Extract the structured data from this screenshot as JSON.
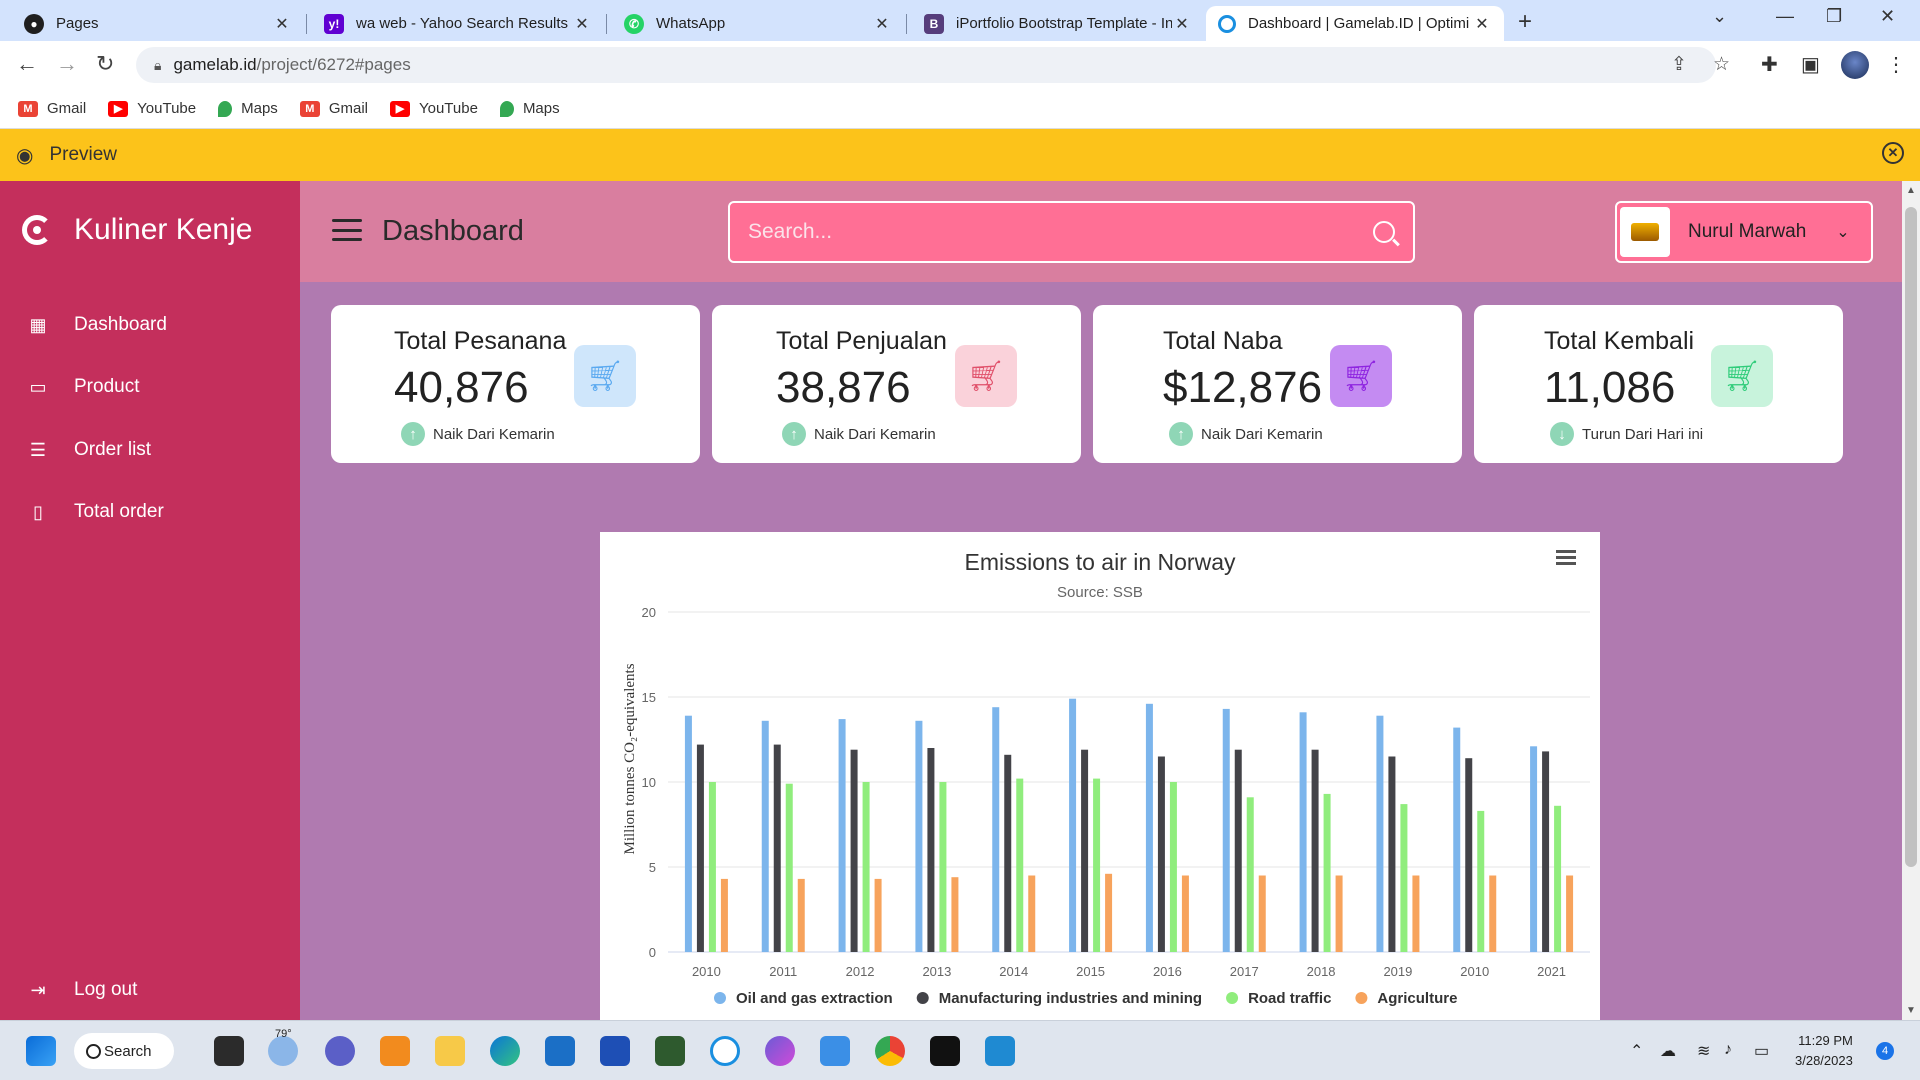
{
  "browser": {
    "tabs": [
      {
        "title": "Pages",
        "icon": "github-icon",
        "color": "#1f1f1f"
      },
      {
        "title": "wa web - Yahoo Search Results",
        "icon": "yahoo-icon",
        "color": "#6001d2"
      },
      {
        "title": "WhatsApp",
        "icon": "whatsapp-icon",
        "color": "#25d366"
      },
      {
        "title": "iPortfolio Bootstrap Template - In",
        "icon": "bootstrap-icon",
        "color": "#563d7c"
      },
      {
        "title": "Dashboard | Gamelab.ID | Optimi",
        "icon": "gamelab-icon",
        "color": "#1a8fe0"
      }
    ],
    "url_host": "gamelab.id",
    "url_path": "/project/6272#pages",
    "bookmarks": [
      {
        "label": "Gmail",
        "icon": "gmail-icon",
        "color": "#ea4335"
      },
      {
        "label": "YouTube",
        "icon": "youtube-icon",
        "color": "#ff0000"
      },
      {
        "label": "Maps",
        "icon": "maps-icon",
        "color": "#34a853"
      },
      {
        "label": "Gmail",
        "icon": "gmail-icon",
        "color": "#ea4335"
      },
      {
        "label": "YouTube",
        "icon": "youtube-icon",
        "color": "#ff0000"
      },
      {
        "label": "Maps",
        "icon": "maps-icon",
        "color": "#34a853"
      }
    ]
  },
  "preview": {
    "label": "Preview"
  },
  "sidebar": {
    "brand": "Kuliner Kenje",
    "items": [
      {
        "label": "Dashboard",
        "icon": "grid-icon"
      },
      {
        "label": "Product",
        "icon": "archive-icon"
      },
      {
        "label": "Order list",
        "icon": "list-icon"
      },
      {
        "label": "Total order",
        "icon": "book-icon"
      }
    ],
    "logout": "Log out"
  },
  "topbar": {
    "title": "Dashboard",
    "search_placeholder": "Search...",
    "user_name": "Nurul Marwah"
  },
  "cards": [
    {
      "label": "Total Pesanana",
      "value": "40,876",
      "trend": "Naik Dari Kemarin",
      "trend_dir": "up",
      "icon": "cart-icon",
      "icon_color": "#5aa9f0",
      "icon_bg": "#cfe6fb"
    },
    {
      "label": "Total Penjualan",
      "value": "38,876",
      "trend": "Naik Dari Kemarin",
      "trend_dir": "up",
      "icon": "cart-plus-icon",
      "icon_color": "#e0506a",
      "icon_bg": "#fad2da"
    },
    {
      "label": "Total Naba",
      "value": "$12,876",
      "trend": "Naik Dari Kemarin",
      "trend_dir": "up",
      "icon": "cart-icon",
      "icon_color": "#8e24e0",
      "icon_bg": "#c48bf2"
    },
    {
      "label": "Total Kembali",
      "value": "11,086",
      "trend": "Turun Dari Hari ini",
      "trend_dir": "down",
      "icon": "cart-download-icon",
      "icon_color": "#2fcc7a",
      "icon_bg": "#c8f3dc"
    }
  ],
  "chart_data": {
    "type": "bar",
    "title": "Emissions to air in Norway",
    "subtitle": "Source: SSB",
    "ylabel": "Million tonnes CO₂-equivalents",
    "xlabel": "",
    "ylim": [
      0,
      20
    ],
    "yticks": [
      0,
      5,
      10,
      15,
      20
    ],
    "categories": [
      "2010",
      "2011",
      "2012",
      "2013",
      "2014",
      "2015",
      "2016",
      "2017",
      "2018",
      "2019",
      "2010",
      "2021"
    ],
    "series": [
      {
        "name": "Oil and gas extraction",
        "color": "#7cb5ec",
        "values": [
          13.9,
          13.6,
          13.7,
          13.6,
          14.4,
          14.9,
          14.6,
          14.3,
          14.1,
          13.9,
          13.2,
          12.1
        ]
      },
      {
        "name": "Manufacturing industries and mining",
        "color": "#434348",
        "values": [
          12.2,
          12.2,
          11.9,
          12.0,
          11.6,
          11.9,
          11.5,
          11.9,
          11.9,
          11.5,
          11.4,
          11.8
        ]
      },
      {
        "name": "Road traffic",
        "color": "#90ed7d",
        "values": [
          10.0,
          9.9,
          10.0,
          10.0,
          10.2,
          10.2,
          10.0,
          9.1,
          9.3,
          8.7,
          8.3,
          8.6
        ]
      },
      {
        "name": "Agriculture",
        "color": "#f7a35c",
        "values": [
          4.3,
          4.3,
          4.3,
          4.4,
          4.5,
          4.6,
          4.5,
          4.5,
          4.5,
          4.5,
          4.5,
          4.5
        ]
      }
    ],
    "legend_position": "bottom",
    "grid": true
  },
  "taskbar": {
    "search_label": "Search",
    "weather": "79°",
    "time": "11:29 PM",
    "date": "3/28/2023",
    "notification_count": "4"
  }
}
